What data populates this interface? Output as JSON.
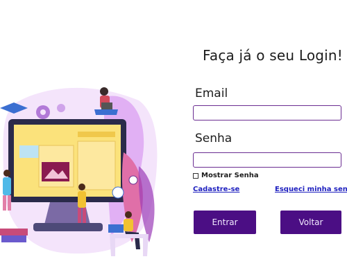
{
  "login": {
    "title": "Faça já o seu Login!",
    "email": {
      "label": "Email",
      "value": "",
      "placeholder": ""
    },
    "password": {
      "label": "Senha",
      "value": "",
      "placeholder": ""
    },
    "show_password_label": "Mostrar Senha",
    "signup_link": "Cadastre-se",
    "forgot_link": "Esqueci minha senha",
    "enter_button": "Entrar",
    "back_button": "Voltar"
  },
  "colors": {
    "accent": "#4b0e84",
    "input_border": "#6a2c91",
    "link": "#1d1fbf"
  }
}
